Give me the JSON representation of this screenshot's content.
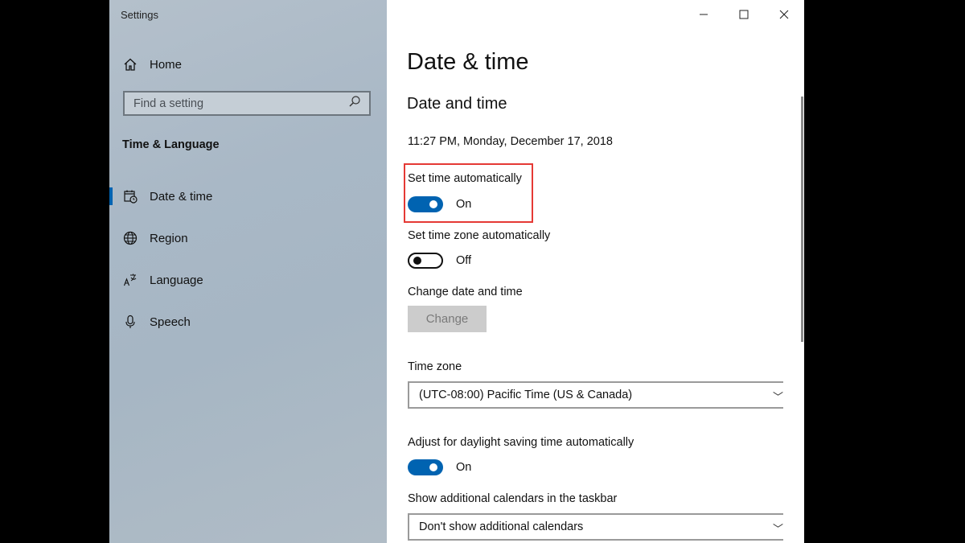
{
  "window": {
    "app_title": "Settings"
  },
  "sidebar": {
    "home_label": "Home",
    "search_placeholder": "Find a setting",
    "section_heading": "Time & Language",
    "items": [
      {
        "label": "Date & time",
        "icon": "calendar-clock-icon",
        "active": true
      },
      {
        "label": "Region",
        "icon": "globe-icon",
        "active": false
      },
      {
        "label": "Language",
        "icon": "language-icon",
        "active": false
      },
      {
        "label": "Speech",
        "icon": "microphone-icon",
        "active": false
      }
    ]
  },
  "titlebar": {
    "minimize": "—",
    "maximize": "☐",
    "close": "✕"
  },
  "main": {
    "page_title": "Date & time",
    "section_title": "Date and time",
    "current_datetime": "11:27 PM, Monday, December 17, 2018",
    "set_time_auto": {
      "label": "Set time automatically",
      "state": "On"
    },
    "set_timezone_auto": {
      "label": "Set time zone automatically",
      "state": "Off"
    },
    "change_datetime": {
      "label": "Change date and time",
      "button": "Change"
    },
    "time_zone": {
      "label": "Time zone",
      "value": "(UTC-08:00) Pacific Time (US & Canada)"
    },
    "daylight_saving": {
      "label": "Adjust for daylight saving time automatically",
      "state": "On"
    },
    "additional_calendars": {
      "label": "Show additional calendars in the taskbar",
      "value": "Don't show additional calendars"
    }
  },
  "colors": {
    "accent": "#0063b1",
    "highlight": "#e53935"
  }
}
